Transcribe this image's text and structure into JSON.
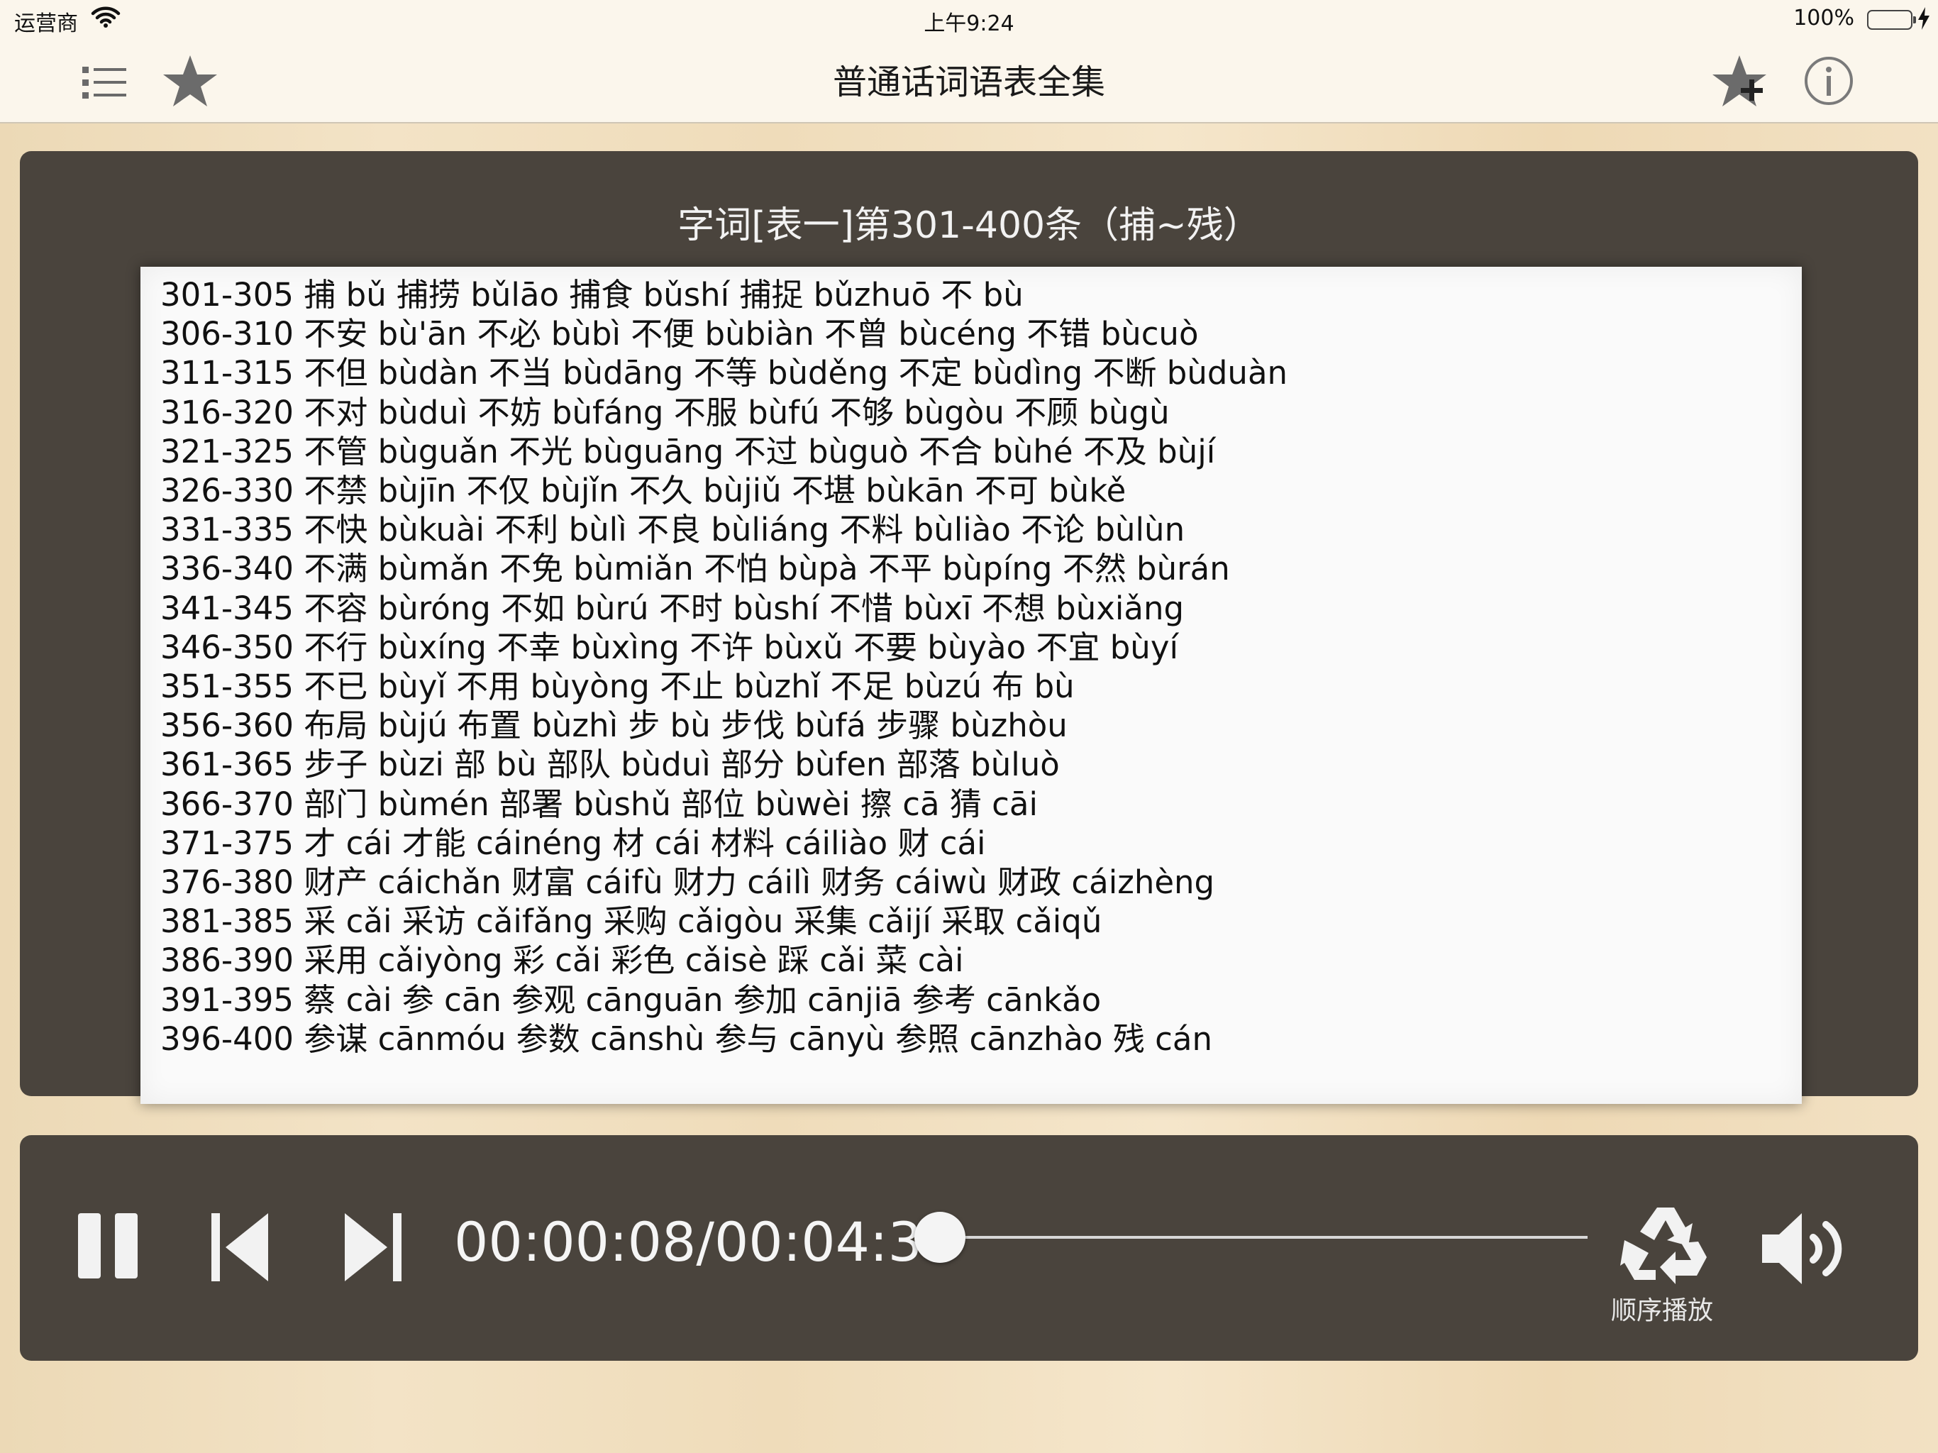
{
  "status_bar": {
    "carrier": "运营商",
    "time": "上午9:24",
    "battery_percent": "100%",
    "battery_level": 1.0
  },
  "nav_bar": {
    "title": "普通话词语表全集",
    "icons": [
      "list-icon",
      "star-icon",
      "star-add-icon",
      "info-icon"
    ]
  },
  "word_panel": {
    "title": "字词[表一]第301-400条（捕~残）",
    "rows": [
      "301-305  捕  bǔ  捕捞  bǔlāo  捕食  bǔshí  捕捉  bǔzhuō  不  bù",
      "306-310  不安  bù'ān  不必  bùbì  不便  bùbiàn  不曾  bùcéng  不错  bùcuò",
      "311-315  不但  bùdàn  不当  bùdāng  不等  bùděng  不定  bùdìng  不断  bùduàn",
      "316-320  不对  bùduì  不妨  bùfáng  不服  bùfú  不够  bùgòu  不顾  bùgù",
      "321-325  不管  bùguǎn  不光  bùguāng  不过  bùguò  不合  bùhé  不及  bùjí",
      "326-330  不禁  bùjīn  不仅  bùjǐn  不久  bùjiǔ  不堪  bùkān  不可  bùkě",
      "331-335  不快  bùkuài  不利  bùlì  不良  bùliáng  不料  bùliào  不论  bùlùn",
      "336-340  不满  bùmǎn  不免  bùmiǎn  不怕  bùpà  不平  bùpíng  不然  bùrán",
      "341-345  不容  bùróng  不如  bùrú  不时  bùshí  不惜  bùxī  不想  bùxiǎng",
      "346-350  不行  bùxíng  不幸  bùxìng  不许  bùxǔ  不要  bùyào  不宜  bùyí",
      "351-355  不已  bùyǐ  不用  bùyòng  不止  bùzhǐ  不足  bùzú  布  bù",
      "356-360  布局  bùjú  布置  bùzhì  步  bù  步伐  bùfá  步骤  bùzhòu",
      "361-365  步子  bùzi  部  bù  部队  bùduì  部分  bùfen  部落  bùluò",
      "366-370  部门  bùmén  部署  bùshǔ  部位  bùwèi  擦  cā  猜  cāi",
      "371-375  才  cái  才能  cáinéng  材  cái  材料  cáiliào  财  cái",
      "376-380  财产  cáichǎn  财富  cáifù  财力  cáilì  财务  cáiwù  财政  cáizhèng",
      "381-385  采  cǎi  采访  cǎifǎng  采购  cǎigòu  采集  cǎijí  采取  cǎiqǔ",
      "386-390  采用  cǎiyòng  彩  cǎi  彩色  cǎisè  踩  cǎi  菜  cài",
      "391-395  蔡  cài  参  cān  参观  cānguān  参加  cānjiā  参考  cānkǎo",
      "396-400  参谋  cānmóu  参数  cānshù  参与  cānyù  参照  cānzhào  残  cán"
    ]
  },
  "player": {
    "time_display": "00:00:08/00:04:38",
    "progress": 0.029,
    "play_mode_label": "顺序播放",
    "icons": [
      "pause-icon",
      "previous-icon",
      "next-icon",
      "recycle-icon",
      "volume-icon"
    ],
    "accent_color": "#e46b22"
  }
}
